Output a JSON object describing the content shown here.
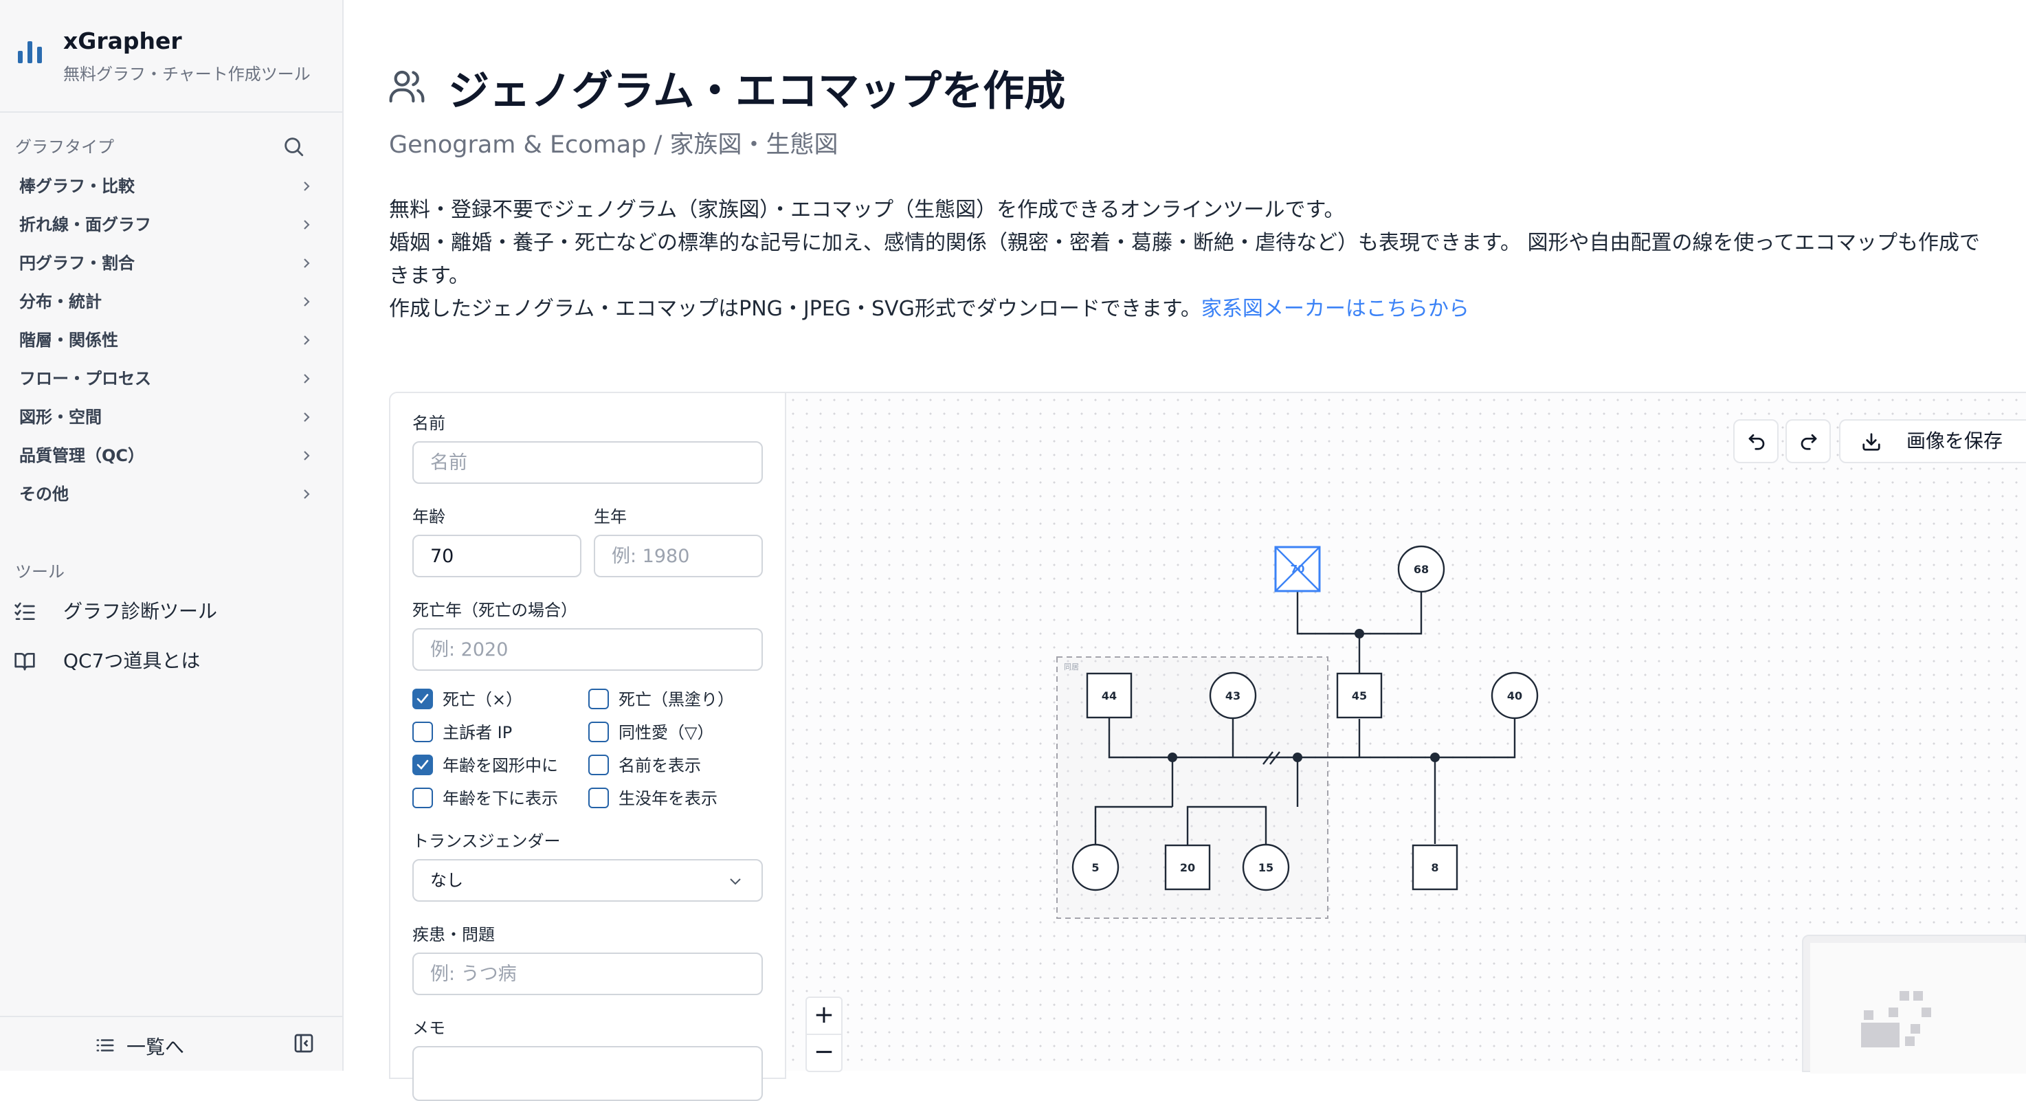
{
  "brand": {
    "name": "xGrapher",
    "tagline": "無料グラフ・チャート作成ツール"
  },
  "sidebar": {
    "graph_types_label": "グラフタイプ",
    "items": [
      {
        "label": "棒グラフ・比較"
      },
      {
        "label": "折れ線・面グラフ"
      },
      {
        "label": "円グラフ・割合"
      },
      {
        "label": "分布・統計"
      },
      {
        "label": "階層・関係性"
      },
      {
        "label": "フロー・プロセス"
      },
      {
        "label": "図形・空間"
      },
      {
        "label": "品質管理（QC）"
      },
      {
        "label": "その他"
      }
    ],
    "tools_label": "ツール",
    "tools": [
      {
        "label": "グラフ診断ツール",
        "icon": "list-check-icon"
      },
      {
        "label": "QC7つ道具とは",
        "icon": "book-icon"
      }
    ],
    "footer": {
      "list_label": "一覧へ"
    }
  },
  "page": {
    "title": "ジェノグラム・エコマップを作成",
    "subtitle": "Genogram & Ecomap / 家族図・生態図",
    "description": {
      "line1": "無料・登録不要でジェノグラム（家族図）・エコマップ（生態図）を作成できるオンラインツールです。",
      "line2": "婚姻・離婚・養子・死亡などの標準的な記号に加え、感情的関係（親密・密着・葛藤・断絶・虐待など）も表現できます。 図形や自由配置の線を使ってエコマップも作成で",
      "line3": "きます。",
      "line4_text": "作成したジェノグラム・エコマップはPNG・JPEG・SVG形式でダウンロードできます。",
      "line4_link": "家系図メーカーはこちらから"
    }
  },
  "form": {
    "name_label": "名前",
    "name_placeholder": "名前",
    "age_label": "年齢",
    "age_value": "70",
    "birth_label": "生年",
    "birth_placeholder": "例: 1980",
    "death_label": "死亡年（死亡の場合）",
    "death_placeholder": "例: 2020",
    "checkboxes": [
      {
        "label": "死亡（×）",
        "checked": true
      },
      {
        "label": "死亡（黒塗り）",
        "checked": false
      },
      {
        "label": "主訴者 IP",
        "checked": false
      },
      {
        "label": "同性愛（▽）",
        "checked": false
      },
      {
        "label": "年齢を図形中に",
        "checked": true
      },
      {
        "label": "名前を表示",
        "checked": false
      },
      {
        "label": "年齢を下に表示",
        "checked": false
      },
      {
        "label": "生没年を表示",
        "checked": false
      }
    ],
    "transgender_label": "トランスジェンダー",
    "transgender_value": "なし",
    "illness_label": "疾患・問題",
    "illness_placeholder": "例: うつ病",
    "memo_label": "メモ"
  },
  "toolbar": {
    "save_label": "画像を保存"
  },
  "zoom": {
    "in_label": "+",
    "out_label": "−"
  },
  "genogram": {
    "nodes": [
      {
        "id": "gf",
        "age": "70",
        "shape": "square",
        "deceased": true,
        "selected": true
      },
      {
        "id": "gm",
        "age": "68",
        "shape": "circle"
      },
      {
        "id": "p1",
        "age": "44",
        "shape": "square"
      },
      {
        "id": "p2",
        "age": "43",
        "shape": "circle"
      },
      {
        "id": "p3",
        "age": "45",
        "shape": "square"
      },
      {
        "id": "p4",
        "age": "40",
        "shape": "circle"
      },
      {
        "id": "c1",
        "age": "5",
        "shape": "circle"
      },
      {
        "id": "c2",
        "age": "20",
        "shape": "square"
      },
      {
        "id": "c3",
        "age": "15",
        "shape": "circle"
      },
      {
        "id": "c4",
        "age": "8",
        "shape": "square"
      }
    ],
    "group_label": "同居"
  },
  "colors": {
    "accent": "#2b6cb0",
    "link": "#3b82f6",
    "selected_node": "#3b82f6"
  }
}
